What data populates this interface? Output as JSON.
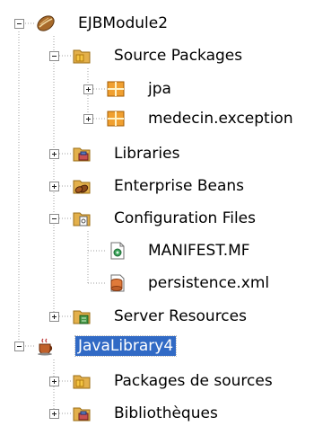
{
  "tree": {
    "project1": {
      "label": "EJBModule2",
      "icon": "bean-icon",
      "children": {
        "source_packages": "Source Packages",
        "pkg_jpa": "jpa",
        "pkg_exception": "medecin.exception",
        "libraries": "Libraries",
        "enterprise_beans": "Enterprise Beans",
        "config_files": "Configuration Files",
        "manifest": "MANIFEST.MF",
        "persistence": "persistence.xml",
        "server_resources": "Server Resources"
      }
    },
    "project2": {
      "label": "JavaLibrary4",
      "icon": "coffee-cup-icon",
      "children": {
        "packages_sources": "Packages de sources",
        "bibliotheques": "Bibliothèques"
      }
    }
  },
  "colors": {
    "selection": "#316ac5",
    "folder": "#e3b04b",
    "package": "#f0a030"
  }
}
